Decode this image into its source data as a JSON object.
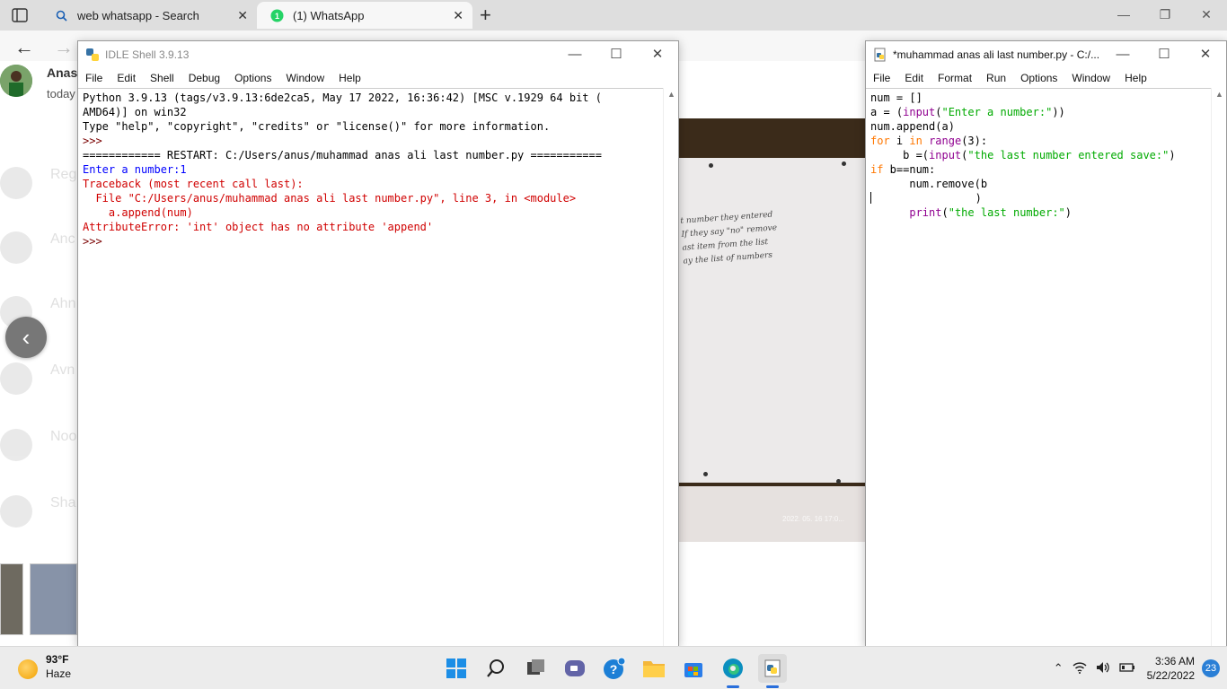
{
  "browser": {
    "tabs": [
      {
        "label": "web whatsapp - Search",
        "active": false,
        "icon": "search-icon"
      },
      {
        "label": "(1) WhatsApp",
        "active": true,
        "icon": "whatsapp-icon",
        "badge": "1"
      }
    ]
  },
  "whatsapp": {
    "contact_name": "Anas",
    "contact_time": "today",
    "ghost_names": [
      "Reg",
      "Anc",
      "Ahn",
      "Avn",
      "Noo",
      "Sha"
    ],
    "photo_handwriting": [
      "t number they entered",
      "If they say \"no\" remove",
      "ast item from the list",
      "ay the list of numbers"
    ],
    "photo_stamp": "2022. 05. 16 17:0..."
  },
  "idle_shell": {
    "title": "IDLE Shell 3.9.13",
    "menu": [
      "File",
      "Edit",
      "Shell",
      "Debug",
      "Options",
      "Window",
      "Help"
    ],
    "lines": [
      {
        "text": "Python 3.9.13 (tags/v3.9.13:6de2ca5, May 17 2022, 16:36:42) [MSC v.1929 64 bit (",
        "color": "black"
      },
      {
        "text": "AMD64)] on win32",
        "color": "black"
      },
      {
        "text": "Type \"help\", \"copyright\", \"credits\" or \"license()\" for more information.",
        "color": "black"
      },
      {
        "text": ">>> ",
        "color": "maroon"
      },
      {
        "text": "============ RESTART: C:/Users/anus/muhammad anas ali last number.py ===========",
        "color": "black"
      },
      {
        "text": "Enter a number:1",
        "color": "blue"
      },
      {
        "text": "Traceback (most recent call last):",
        "color": "red"
      },
      {
        "text": "  File \"C:/Users/anus/muhammad anas ali last number.py\", line 3, in <module>",
        "color": "red"
      },
      {
        "text": "    a.append(num)",
        "color": "red"
      },
      {
        "text": "AttributeError: 'int' object has no attribute 'append'",
        "color": "red"
      },
      {
        "text": ">>> ",
        "color": "maroon"
      }
    ]
  },
  "idle_editor": {
    "title": "*muhammad anas ali last number.py - C:/...",
    "menu": [
      "File",
      "Edit",
      "Format",
      "Run",
      "Options",
      "Window",
      "Help"
    ],
    "code": [
      [
        {
          "t": "num = []",
          "c": "plain"
        }
      ],
      [
        {
          "t": "a = (",
          "c": "plain"
        },
        {
          "t": "input",
          "c": "bi"
        },
        {
          "t": "(",
          "c": "plain"
        },
        {
          "t": "\"Enter a number:\"",
          "c": "str"
        },
        {
          "t": "))",
          "c": "plain"
        }
      ],
      [
        {
          "t": "num.append(a)",
          "c": "plain"
        }
      ],
      [
        {
          "t": "for",
          "c": "kw"
        },
        {
          "t": " i ",
          "c": "plain"
        },
        {
          "t": "in",
          "c": "kw"
        },
        {
          "t": " ",
          "c": "plain"
        },
        {
          "t": "range",
          "c": "bi"
        },
        {
          "t": "(3):",
          "c": "plain"
        }
      ],
      [
        {
          "t": "     b =(",
          "c": "plain"
        },
        {
          "t": "input",
          "c": "bi"
        },
        {
          "t": "(",
          "c": "plain"
        },
        {
          "t": "\"the last number entered save:\"",
          "c": "str"
        },
        {
          "t": ")",
          "c": "plain"
        }
      ],
      [
        {
          "t": "if",
          "c": "kw"
        },
        {
          "t": " b==num:",
          "c": "plain"
        }
      ],
      [
        {
          "t": "      num.remove(b",
          "c": "plain"
        }
      ],
      [
        {
          "t": "                )",
          "c": "plain"
        }
      ],
      [
        {
          "t": "      ",
          "c": "plain"
        },
        {
          "t": "print",
          "c": "bi"
        },
        {
          "t": "(",
          "c": "plain"
        },
        {
          "t": "\"the last number:\"",
          "c": "str"
        },
        {
          "t": ")",
          "c": "plain"
        }
      ]
    ]
  },
  "taskbar": {
    "weather_temp": "93°F",
    "weather_desc": "Haze",
    "time": "3:36 AM",
    "date": "5/22/2022",
    "notifications": "23"
  }
}
